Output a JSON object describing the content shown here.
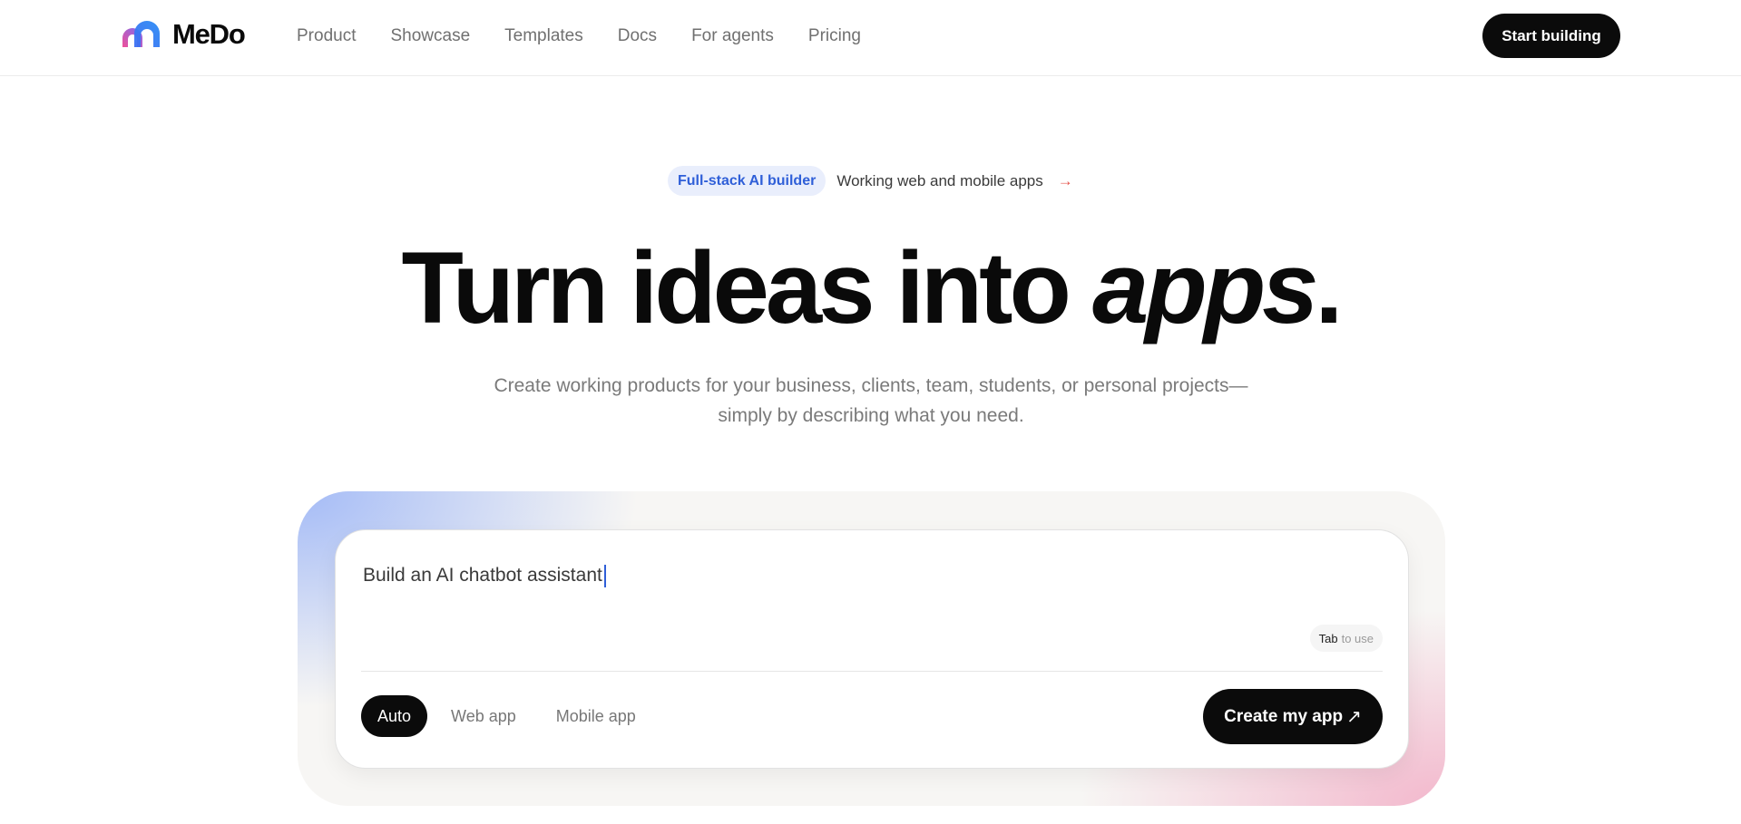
{
  "brand": {
    "name": "MeDo",
    "logo_icon": "medo-logo-icon"
  },
  "nav": {
    "items": [
      {
        "label": "Product"
      },
      {
        "label": "Showcase"
      },
      {
        "label": "Templates"
      },
      {
        "label": "Docs"
      },
      {
        "label": "For agents"
      },
      {
        "label": "Pricing"
      }
    ]
  },
  "header": {
    "cta_label": "Start building"
  },
  "announcement": {
    "badge": "Full-stack AI builder",
    "text": "Working web and mobile apps",
    "arrow": "→"
  },
  "hero": {
    "title_main": "Turn ideas into",
    "title_emphasis": "apps",
    "title_end": ".",
    "subtitle_line1": "Create working products for your business, clients, team, students, or personal projects—",
    "subtitle_line2": "simply by describing what you need."
  },
  "prompt": {
    "value": "Build an AI chatbot assistant",
    "hint_key": "Tab",
    "hint_text": "to use",
    "modes": [
      {
        "label": "Auto",
        "active": true
      },
      {
        "label": "Web app",
        "active": false
      },
      {
        "label": "Mobile app",
        "active": false
      }
    ],
    "submit_label": "Create my app",
    "submit_icon": "↗"
  },
  "colors": {
    "accent_blue": "#2f5fd8",
    "badge_bg": "#e9eefc",
    "arrow_red": "#e5534b",
    "button_dark": "#0b0b0b"
  }
}
